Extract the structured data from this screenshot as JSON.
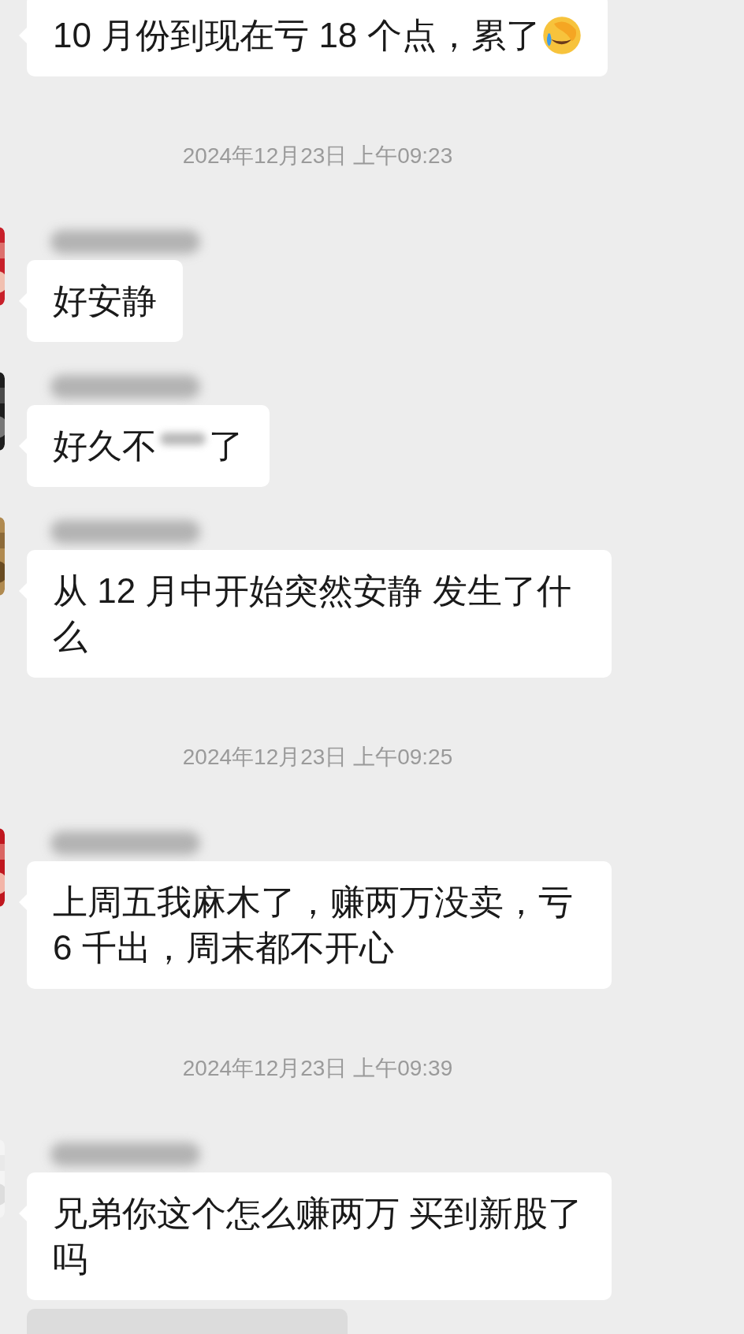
{
  "messages": [
    {
      "kind": "message",
      "segments": [
        {
          "kind": "text",
          "text": "10 月份到现在亏 18 个点，累了"
        },
        {
          "kind": "emoji"
        }
      ]
    },
    {
      "kind": "time",
      "text": "2024年12月23日 上午09:23"
    },
    {
      "kind": "message",
      "avatar": {
        "kind": "picture"
      },
      "name_blurred": true,
      "segments": [
        {
          "kind": "text",
          "text": "好安静"
        }
      ]
    },
    {
      "kind": "message",
      "avatar": {
        "kind": "picture"
      },
      "name_blurred": true,
      "segments": [
        {
          "kind": "text",
          "text": "好久不"
        },
        {
          "kind": "blur"
        },
        {
          "kind": "text",
          "text": "了"
        }
      ]
    },
    {
      "kind": "message",
      "avatar": {
        "kind": "picture"
      },
      "name_blurred": true,
      "segments": [
        {
          "kind": "text",
          "text": "从 12 月中开始突然安静 发生了什么"
        }
      ]
    },
    {
      "kind": "time",
      "text": "2024年12月23日 上午09:25"
    },
    {
      "kind": "message",
      "avatar": {
        "kind": "picture"
      },
      "name_blurred": true,
      "segments": [
        {
          "kind": "text",
          "text": "上周五我麻木了，赚两万没卖，亏 6 千出，周末都不开心"
        }
      ]
    },
    {
      "kind": "time",
      "text": "2024年12月23日 上午09:39"
    },
    {
      "kind": "message",
      "avatar": {
        "kind": "picture"
      },
      "name_blurred": true,
      "segments": [
        {
          "kind": "text",
          "text": "兄弟你这个怎么赚两万  买到新股了吗"
        }
      ]
    },
    {
      "kind": "quote"
    }
  ]
}
